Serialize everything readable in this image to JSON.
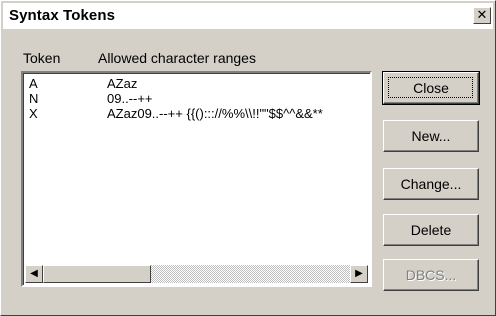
{
  "dialog": {
    "title": "Syntax Tokens",
    "close_glyph": "✕"
  },
  "list": {
    "headers": {
      "token": "Token",
      "ranges": "Allowed character ranges"
    },
    "rows": [
      {
        "token": "A",
        "ranges": "AZaz"
      },
      {
        "token": "N",
        "ranges": "09..--++"
      },
      {
        "token": "X",
        "ranges": "AZaz09..--++  {{()::://%%\\\\!!\"\"$$^^&&**"
      }
    ]
  },
  "scrollbar": {
    "left_arrow": "◀",
    "right_arrow": "▶"
  },
  "buttons": {
    "close": "Close",
    "new": "New...",
    "change": "Change...",
    "delete": "Delete",
    "dbcs": "DBCS..."
  }
}
